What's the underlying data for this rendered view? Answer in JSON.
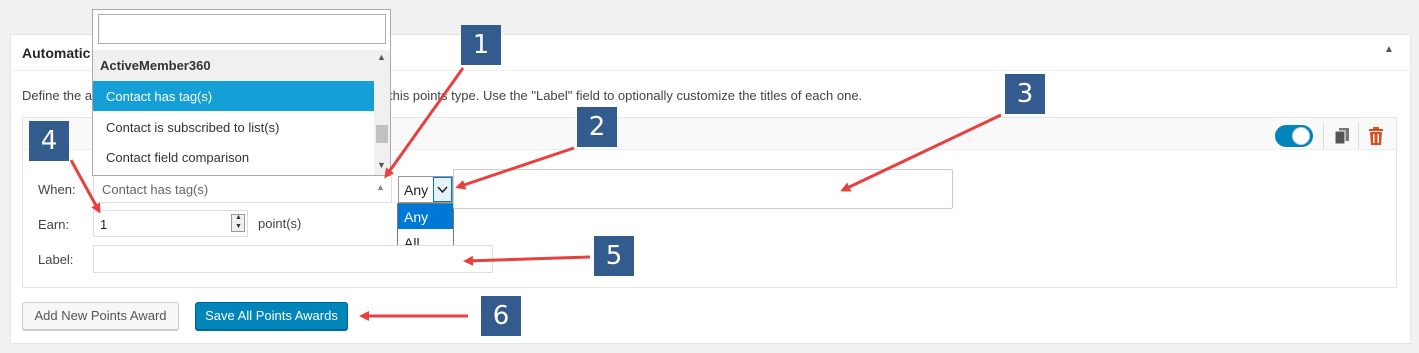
{
  "panel": {
    "title": "Automatic",
    "description_left": "Define the a",
    "description_right": "this points type. Use the \"Label\" field to optionally customize the titles of each one."
  },
  "award": {
    "toggle_on": true,
    "when_label": "When:",
    "when_value": "Contact has tag(s)",
    "match_value": "Any",
    "match_options": [
      "Any",
      "All"
    ],
    "earn_label": "Earn:",
    "earn_value": "1",
    "earn_unit": "point(s)",
    "label_label": "Label:",
    "label_value": ""
  },
  "trigger_dropdown": {
    "search_value": "",
    "group": "ActiveMember360",
    "items": [
      "Contact has tag(s)",
      "Contact is subscribed to list(s)",
      "Contact field comparison"
    ],
    "selected_index": 0
  },
  "buttons": {
    "add_new": "Add New Points Award",
    "save_all": "Save All Points Awards"
  },
  "callouts": [
    "1",
    "2",
    "3",
    "4",
    "5",
    "6"
  ],
  "colors": {
    "primary": "#0085ba",
    "badge": "#345b8d",
    "arrow": "#e8403f",
    "selected_item": "#14a0d6",
    "delete": "#d54e21"
  },
  "icons": {
    "collapse": "triangle-up-icon",
    "copy": "copy-icon",
    "delete": "trash-icon"
  }
}
